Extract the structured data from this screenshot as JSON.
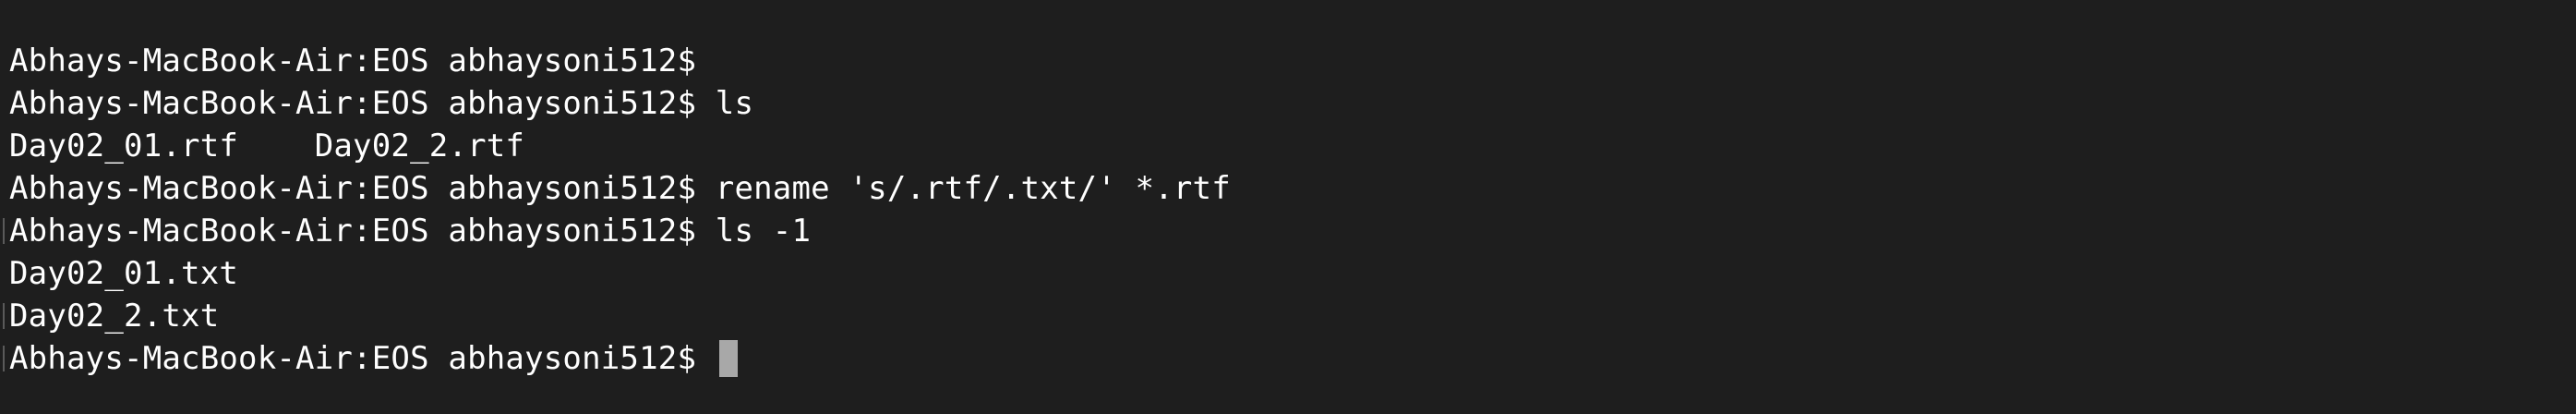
{
  "terminal": {
    "lines": [
      {
        "prompt": "Abhays-MacBook-Air:EOS abhaysoni512$",
        "command": ""
      },
      {
        "prompt": "Abhays-MacBook-Air:EOS abhaysoni512$",
        "command": "ls"
      },
      {
        "output": "Day02_01.rtf    Day02_2.rtf"
      },
      {
        "prompt": "Abhays-MacBook-Air:EOS abhaysoni512$",
        "command": "rename 's/.rtf/.txt/' *.rtf"
      },
      {
        "prompt": "Abhays-MacBook-Air:EOS abhaysoni512$",
        "command": "ls -1"
      },
      {
        "output": "Day02_01.txt"
      },
      {
        "output": "Day02_2.txt"
      },
      {
        "prompt": "Abhays-MacBook-Air:EOS abhaysoni512$",
        "command": ""
      }
    ],
    "colors": {
      "background": "#1e1e1e",
      "text": "#ffffff",
      "cursor": "#a8a8a8"
    }
  }
}
